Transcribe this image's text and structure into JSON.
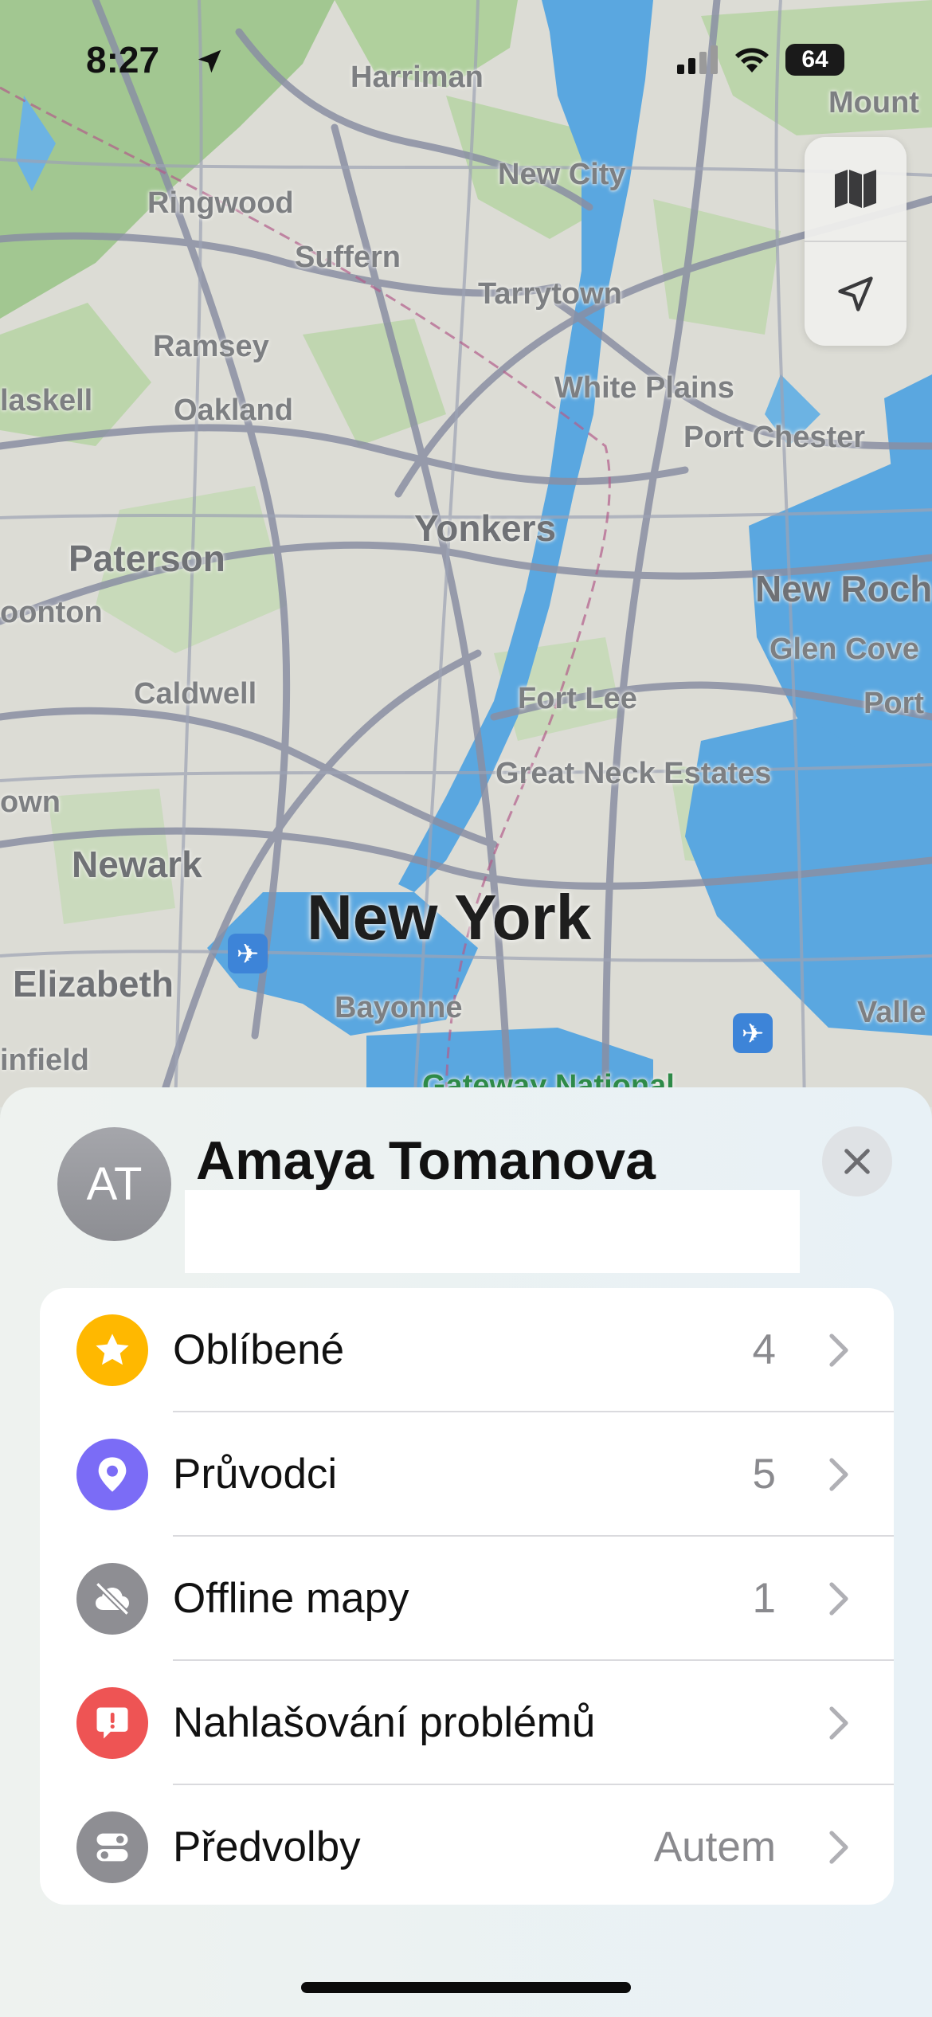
{
  "status_bar": {
    "time": "8:27",
    "battery": "64"
  },
  "map": {
    "labels": {
      "harriman": "Harriman",
      "mount": "Mount",
      "new_city": "New City",
      "ringwood": "Ringwood",
      "suffern": "Suffern",
      "tarrytown": "Tarrytown",
      "ramsey": "Ramsey",
      "haskell": "laskell",
      "oakland": "Oakland",
      "white_plains": "White Plains",
      "port_chester": "Port Chester",
      "yonkers": "Yonkers",
      "paterson": "Paterson",
      "new_rochelle": "New Roch",
      "pompton": "oonton",
      "glen_cove": "Glen Cove",
      "caldwell": "Caldwell",
      "fort_lee": "Fort Lee",
      "port": "Port",
      "great_neck": "Great Neck Estates",
      "town": "own",
      "newark": "Newark",
      "new_york": "New York",
      "elizabeth": "Elizabeth",
      "bayonne": "Bayonne",
      "valley": "Valle",
      "plainfield": "infield",
      "gateway": "Gateway National"
    }
  },
  "profile": {
    "initials": "AT",
    "name": "Amaya Tomanova"
  },
  "menu": [
    {
      "label": "Oblíbené",
      "value": "4",
      "color": "#FFB800"
    },
    {
      "label": "Průvodci",
      "value": "5",
      "color": "#7B6CF6"
    },
    {
      "label": "Offline mapy",
      "value": "1",
      "color": "#8E8E93"
    },
    {
      "label": "Nahlašování problémů",
      "value": "",
      "color": "#EE5454"
    },
    {
      "label": "Předvolby",
      "value": "Autem",
      "color": "#8E8E93"
    }
  ]
}
